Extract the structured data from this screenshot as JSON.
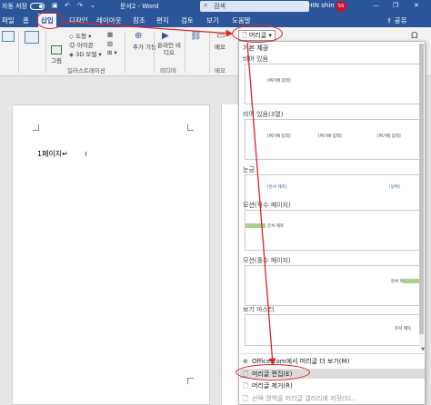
{
  "titlebar": {
    "autosave": "자동 저장",
    "doc_title": "문서2 - Word",
    "search_placeholder": "검색",
    "user": "SHIN shin",
    "avatar": "SS"
  },
  "tabs": [
    "파일",
    "홈",
    "삽입",
    "디자인",
    "레이아웃",
    "참조",
    "편지",
    "검토",
    "보기",
    "도움말"
  ],
  "share_label": "공유",
  "ribbon": {
    "shapes": "도형",
    "icons": "아이콘",
    "models3d": "3D 모델",
    "picture": "그림",
    "addins": "추가 기능",
    "online_video": "온라인 비디오",
    "memo": "메모",
    "group_illustrations": "일러스트레이션",
    "group_media": "미디어",
    "group_memo": "메모",
    "header_button": "머리글"
  },
  "document": {
    "page_text": "1페이지↵"
  },
  "dropdown": {
    "section_builtin": "기본 제공",
    "items": [
      {
        "label": "비어 있음",
        "placeholder": "[여기에 입력]"
      },
      {
        "label": "비어 있음(3열)",
        "placeholders": [
          "[여기에 입력]",
          "[여기에 입력]",
          "[여기에 입력]"
        ]
      },
      {
        "label": "눈금",
        "placeholders": [
          "[문서 제목]",
          "[날짜]"
        ]
      },
      {
        "label": "모션(짝수 페이지)",
        "placeholder": "문서 제목"
      },
      {
        "label": "모션(홀수 페이지)",
        "placeholder": "문서 제목"
      },
      {
        "label": "보기 마스터",
        "placeholder": "문서 제목"
      }
    ],
    "menu": {
      "more_office": "Office.com에서 머리글 더 보기(M)",
      "edit_header": "머리글 편집(E)",
      "remove_header": "머리글 제거(R)",
      "save_selection": "선택 영역을 머리글 갤러리에 저장(S)..."
    }
  }
}
